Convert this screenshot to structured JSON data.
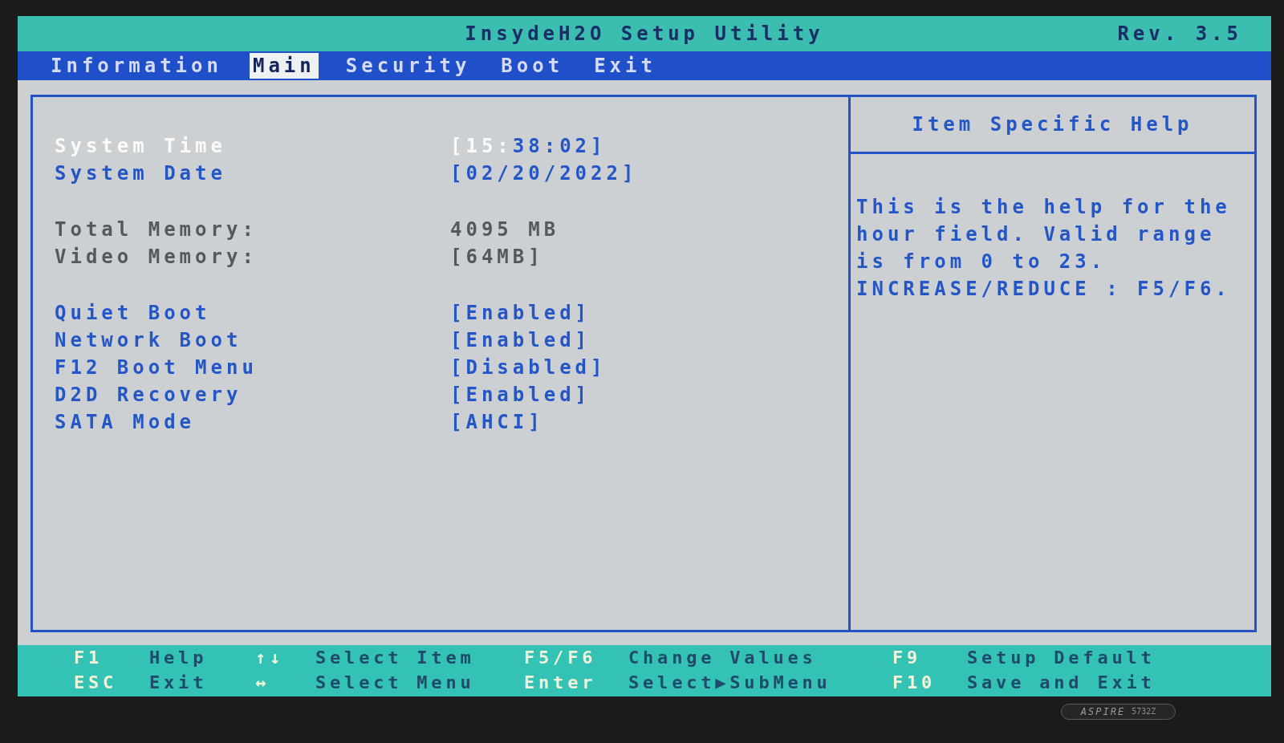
{
  "title_bar": {
    "title": "InsydeH2O Setup Utility",
    "revision": "Rev. 3.5"
  },
  "tabs": [
    {
      "label": "Information",
      "selected": false
    },
    {
      "label": "Main",
      "selected": true
    },
    {
      "label": "Security",
      "selected": false
    },
    {
      "label": "Boot",
      "selected": false
    },
    {
      "label": "Exit",
      "selected": false
    }
  ],
  "main": {
    "groups": [
      {
        "items": [
          {
            "kind": "setting",
            "label": "System Time",
            "selected": true,
            "value_parts": [
              {
                "text": "[15:",
                "selected": true
              },
              {
                "text": "38:02]",
                "selected": false
              }
            ]
          },
          {
            "kind": "setting",
            "label": "System Date",
            "selected": false,
            "value": "[02/20/2022]"
          }
        ]
      },
      {
        "items": [
          {
            "kind": "info",
            "label": "Total Memory:",
            "selected": false,
            "value": "4095 MB"
          },
          {
            "kind": "info",
            "label": "Video Memory:",
            "selected": false,
            "value": "[64MB]"
          }
        ]
      },
      {
        "items": [
          {
            "kind": "setting",
            "label": "Quiet Boot",
            "selected": false,
            "value": "[Enabled]"
          },
          {
            "kind": "setting",
            "label": "Network Boot",
            "selected": false,
            "value": "[Enabled]"
          },
          {
            "kind": "setting",
            "label": "F12 Boot Menu",
            "selected": false,
            "value": "[Disabled]"
          },
          {
            "kind": "setting",
            "label": "D2D Recovery",
            "selected": false,
            "value": "[Enabled]"
          },
          {
            "kind": "setting",
            "label": "SATA Mode",
            "selected": false,
            "value": "[AHCI]"
          }
        ]
      }
    ]
  },
  "help": {
    "title": "Item Specific Help",
    "paragraphs": [
      "This is the help for the hour field. Valid range is from 0 to 23.",
      "INCREASE/REDUCE : F5/F6."
    ]
  },
  "footer": {
    "rows": [
      [
        {
          "key": "F1",
          "action": "Help"
        },
        {
          "key": "↑↓",
          "action": "Select Item"
        },
        {
          "key": "F5/F6",
          "action": "Change Values"
        },
        {
          "key": "F9",
          "action": "Setup Default"
        }
      ],
      [
        {
          "key": "ESC",
          "action": "Exit"
        },
        {
          "key": "↔",
          "action": "Select Menu"
        },
        {
          "key": "Enter",
          "action": "Select▶SubMenu"
        },
        {
          "key": "F10",
          "action": "Save and Exit"
        }
      ]
    ]
  },
  "bezel": {
    "model_badge": {
      "brand": "ASPIRE",
      "model": "5732Z"
    }
  }
}
